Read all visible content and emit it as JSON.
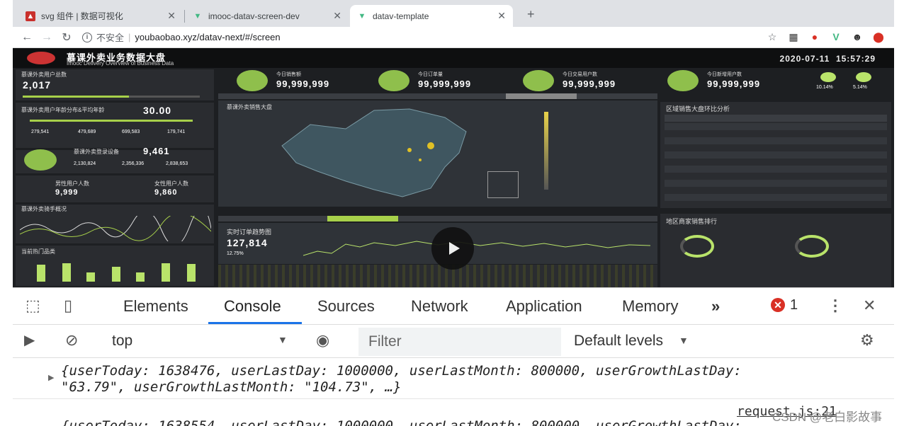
{
  "browser": {
    "tabs": [
      {
        "title": "svg 组件 | 数据可视化",
        "icon": "red-a-icon"
      },
      {
        "title": "imooc-datav-screen-dev",
        "icon": "vue-icon"
      },
      {
        "title": "datav-template",
        "icon": "vue-icon"
      }
    ],
    "security": "不安全",
    "url": "youbaobao.xyz/datav-next/#/screen"
  },
  "dashboard": {
    "title": "慕课外卖业务数据大盘",
    "subtitle": "Imooc Delivery Overview of Business Data",
    "datetime": "2020-07-11",
    "time": "15:57:29",
    "user_total_label": "慕课外卖用户总数",
    "user_total": "2,017",
    "avg_age_label": "慕课外卖用户年龄分布&平均年龄",
    "avg_age": "30.00",
    "age_values": [
      "279,541",
      "479,689",
      "699,583",
      "179,741"
    ],
    "device_label": "慕课外卖登录设备",
    "device_total": "9,461",
    "device_values": [
      "2,130,824",
      "2,356,336",
      "2,838,653"
    ],
    "male_label": "男性用户人数",
    "male_count": "9,999",
    "female_label": "女性用户人数",
    "female_count": "9,860",
    "rider_label": "慕课外卖骑手概况",
    "hot_label": "当前热门品类",
    "kpis": [
      {
        "label": "今日销售额",
        "value": "99,999,999"
      },
      {
        "label": "今日订单量",
        "value": "99,999,999"
      },
      {
        "label": "今日交易用户数",
        "value": "99,999,999"
      },
      {
        "label": "今日新增用户数",
        "value": "99,999,999"
      }
    ],
    "growth": [
      "10.14%",
      "5.14%"
    ],
    "map_title": "慕课外卖销售大盘",
    "region_title": "区域销售大盘环比分析",
    "rank_title": "地区商家销售排行",
    "realtime_title": "实时订单趋势图",
    "realtime_value": "127,814",
    "realtime_pct": "12.75%"
  },
  "devtools": {
    "tabs": [
      "Elements",
      "Console",
      "Sources",
      "Network",
      "Application",
      "Memory"
    ],
    "more": "»",
    "errors": "1",
    "context": "top",
    "filter_placeholder": "Filter",
    "levels": "Default levels",
    "log1_line1": "{userToday: 1638476, userLastDay: 1000000, userLastMonth: 800000, userGrowthLastDay:",
    "log1_line2": "\"63.79\", userGrowthLastMonth: \"104.73\", …}",
    "log2": "{userToday: 1638554, userLastDay: 1000000, userLastMonth: 800000, userGrowthLastDay:",
    "source": "request.js:21",
    "watermark": "CSDN @老白影故事"
  }
}
